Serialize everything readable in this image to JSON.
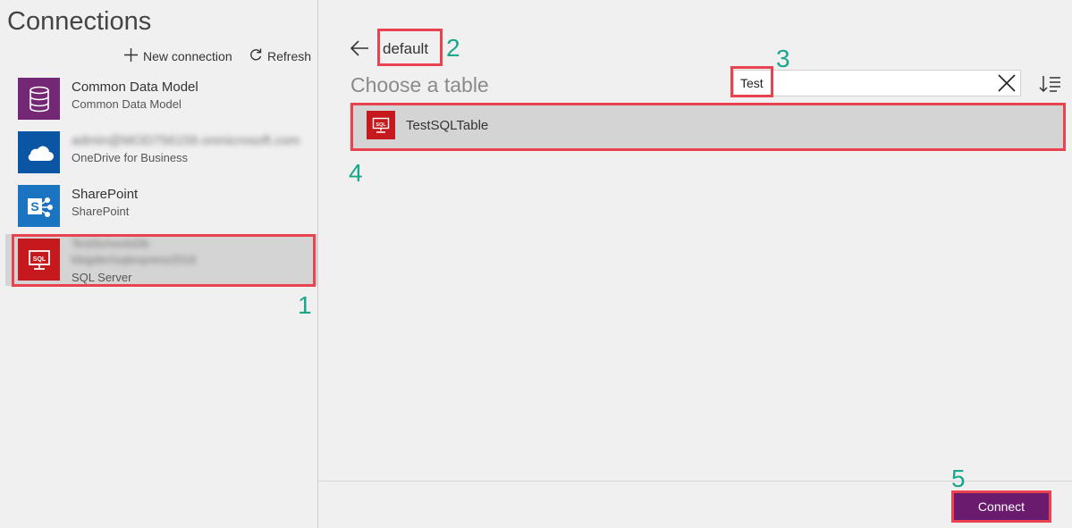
{
  "left_pane": {
    "title": "Connections",
    "toolbar": {
      "new_connection_label": "New connection",
      "refresh_label": "Refresh"
    },
    "connections": [
      {
        "name": "Common Data Model",
        "subtitle": "Common Data Model",
        "icon": "database-icon",
        "color": "#742774"
      },
      {
        "name": "admin@MOD756159.onmicrosoft.com",
        "subtitle": "OneDrive for Business",
        "icon": "cloud-icon",
        "color": "#0b55a5"
      },
      {
        "name": "SharePoint",
        "subtitle": "SharePoint",
        "icon": "sharepoint-icon",
        "color": "#1b74c1"
      },
      {
        "name": "TestSchoolsDb",
        "name_line2": "kbigdev\\sqlexpress2016",
        "subtitle": "SQL Server",
        "icon": "sql-icon",
        "color": "#c5191d",
        "selected": true
      }
    ]
  },
  "right_pane": {
    "database": "default",
    "heading": "Choose a table",
    "search_value": "Test",
    "tables": [
      {
        "name": "TestSQLTable",
        "icon": "sql-icon"
      }
    ],
    "connect_label": "Connect"
  },
  "callout_numbers": [
    "1",
    "2",
    "3",
    "4",
    "5"
  ],
  "colors": {
    "callout_border": "#e8434f",
    "callout_number": "#1aa78c",
    "connect_button": "#6b1b6e",
    "sql_red": "#c5191d"
  }
}
